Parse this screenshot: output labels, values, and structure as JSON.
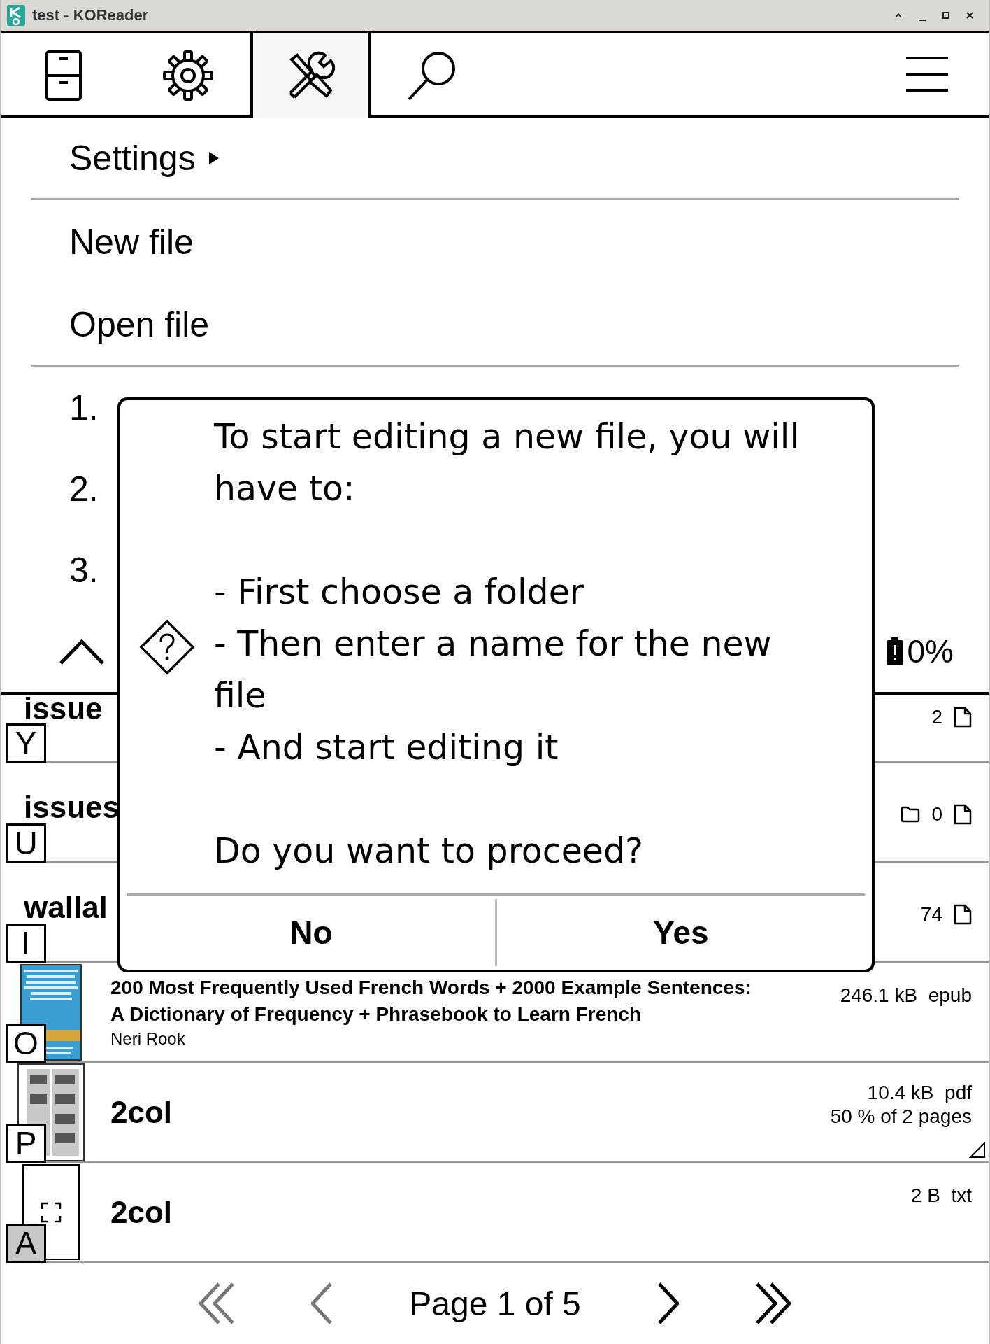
{
  "window": {
    "title": "test - KOReader"
  },
  "tabs": [
    {
      "kind": "files",
      "selected": false
    },
    {
      "kind": "settings",
      "selected": false
    },
    {
      "kind": "tools",
      "selected": true
    },
    {
      "kind": "search",
      "selected": false
    }
  ],
  "menu": {
    "header": "Settings",
    "groups": [
      [
        "New file",
        "Open file"
      ],
      [
        "1.",
        "2.",
        "3."
      ]
    ]
  },
  "status": {
    "battery": "0%"
  },
  "files": [
    {
      "kind": "entry",
      "name": "issue",
      "count": "2",
      "folders": false,
      "hint": "Y",
      "selected": false
    },
    {
      "kind": "entry",
      "name": "issues",
      "count": "0",
      "folders": true,
      "hint": "U",
      "selected": false
    },
    {
      "kind": "entry",
      "name": "wallal",
      "count": "74",
      "folders": false,
      "hint": "I",
      "selected": false
    },
    {
      "kind": "cover",
      "title_lines": [
        "200 Most Frequently Used French Words + 2000 Example Sentences:",
        "A Dictionary of Frequency + Phrasebook to Learn French"
      ],
      "author": "Neri Rook",
      "meta": [
        "246.1 kB  epub"
      ],
      "dogear": false,
      "hint": "O",
      "selected": false
    },
    {
      "kind": "pages",
      "title_lines": [
        "2col"
      ],
      "meta": [
        "10.4 kB  pdf",
        "50 % of 2 pages"
      ],
      "dogear": true,
      "hint": "P",
      "selected": false
    },
    {
      "kind": "blank",
      "title_lines": [
        "2col"
      ],
      "meta": [
        "2 B  txt"
      ],
      "dogear": false,
      "hint": "A",
      "selected": true
    }
  ],
  "pagination": {
    "label": "Page 1 of 5",
    "buttons": [
      {
        "kind": "first",
        "disabled": true
      },
      {
        "kind": "prev",
        "disabled": true
      },
      {
        "kind": "next",
        "disabled": false
      },
      {
        "kind": "last",
        "disabled": false
      }
    ]
  },
  "dialog": {
    "message": "To start editing a new file, you will have to:\n\n- First choose a folder\n- Then enter a name for the new file\n- And start editing it\n\nDo you want to proceed?",
    "buttons": [
      "No",
      "Yes"
    ]
  }
}
